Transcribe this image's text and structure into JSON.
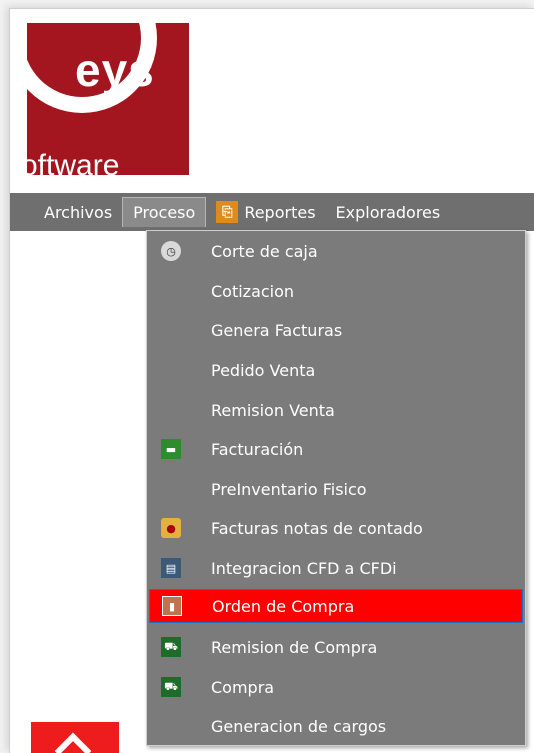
{
  "logo": {
    "brand_text": "eys",
    "sub_text": "oftware",
    "brand_color": "#a4161f"
  },
  "menubar": {
    "items": [
      {
        "label": "Archivos"
      },
      {
        "label": "Proceso"
      },
      {
        "label": "Reportes",
        "icon": "reportes-icon"
      },
      {
        "label": "Exploradores"
      }
    ],
    "active": "Proceso",
    "background": "#6f6f6f"
  },
  "dropdown": {
    "background": "#7b7b7b",
    "highlight_color": "#ff0000",
    "items": [
      {
        "label": "Corte de caja",
        "icon": "clock-calendar-icon"
      },
      {
        "label": "Cotizacion"
      },
      {
        "label": "Genera Facturas"
      },
      {
        "label": "Pedido Venta"
      },
      {
        "label": "Remision Venta"
      },
      {
        "label": "Facturación",
        "icon": "truck-icon"
      },
      {
        "label": "PreInventario Fisico"
      },
      {
        "label": "Facturas notas de contado",
        "icon": "sticker-icon"
      },
      {
        "label": "Integracion CFD a CFDi",
        "icon": "document-icon"
      },
      {
        "label": "Orden de Compra",
        "icon": "order-icon",
        "selected": true
      },
      {
        "label": "Remision de Compra",
        "icon": "cart-icon"
      },
      {
        "label": "Compra",
        "icon": "cart-icon"
      },
      {
        "label": "Generacion de cargos"
      }
    ]
  }
}
